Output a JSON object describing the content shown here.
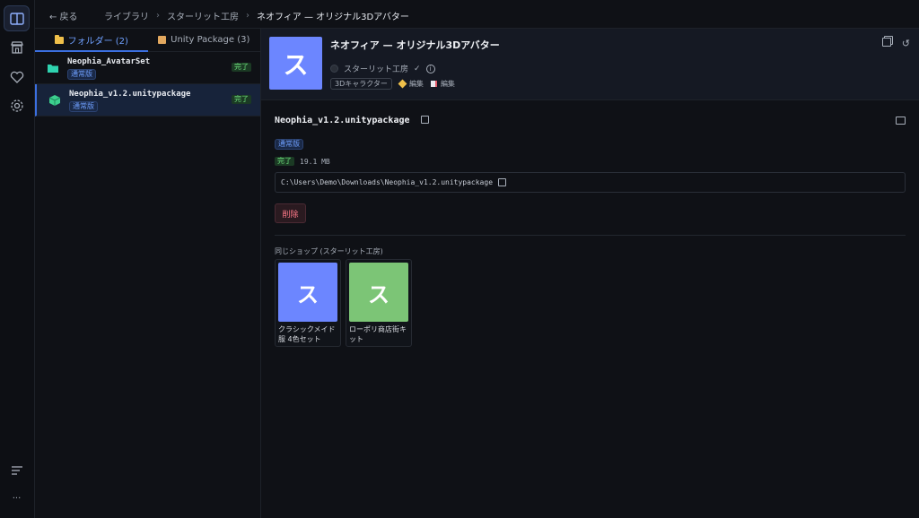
{
  "nav": {
    "back_label": "← 戻る",
    "breadcrumbs": [
      "ライブラリ",
      "スターリット工房",
      "ネオフィア — オリジナル3Dアバター"
    ],
    "separator": "›"
  },
  "rail": {
    "icons": [
      "library-icon",
      "store-icon",
      "heart-icon",
      "gear-icon"
    ],
    "bottom_icons": [
      "sort-icon",
      "more-icon"
    ],
    "more_label": "···"
  },
  "tabs": [
    {
      "label": "フォルダー (2)",
      "icon": "folder-icon",
      "active": true
    },
    {
      "label": "Unity Package (3)",
      "icon": "package-icon",
      "active": false
    }
  ],
  "items": [
    {
      "name": "Neophia_AvatarSet",
      "tag": "通常版",
      "status": "完了",
      "icon": "folder-icon",
      "selected": false
    },
    {
      "name": "Neophia_v1.2.unitypackage",
      "tag": "通常版",
      "status": "完了",
      "icon": "cube-icon",
      "selected": true
    }
  ],
  "product": {
    "thumb_char": "ス",
    "title": "ネオフィア — オリジナル3Dアバター",
    "shop": "スターリット工房",
    "verified_mark": "✓",
    "info_mark": "i",
    "chips": [
      {
        "label": "3Dキャラクター",
        "style": "outline"
      },
      {
        "label": "編集",
        "icon": "tag-icon"
      },
      {
        "label": "編集",
        "icon": "note-icon"
      }
    ],
    "actions": [
      "copy-icon",
      "refresh-icon"
    ],
    "refresh_glyph": "↺"
  },
  "file": {
    "name": "Neophia_v1.2.unitypackage",
    "edition": "通常版",
    "status": "完了",
    "size": "19.1 MB",
    "path": "C:\\Users\\Demo\\Downloads\\Neophia_v1.2.unitypackage",
    "delete_label": "削除"
  },
  "related": {
    "heading": "同じショップ (スターリット工房)",
    "cards": [
      {
        "thumb_char": "ス",
        "label": "クラシックメイド服 4色セット",
        "color": "#6c86ff"
      },
      {
        "thumb_char": "ス",
        "label": "ローポリ商店街キット",
        "color": "#7cc576"
      }
    ]
  },
  "colors": {
    "accent": "#3b6fe0",
    "success": "#6ee07d",
    "danger": "#ff7a8a"
  }
}
